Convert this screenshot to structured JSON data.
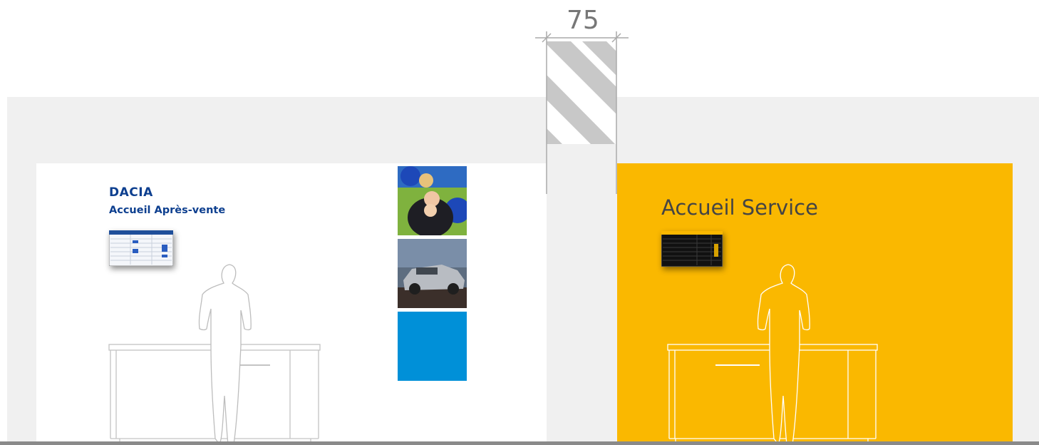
{
  "brand": "DACIA",
  "left_zone": {
    "title": "Accueil Après-vente"
  },
  "right_zone": {
    "title": "Accueil Service"
  },
  "dimension": {
    "value": "75"
  },
  "colors": {
    "wall": "#f0f0f0",
    "left_panel": "#ffffff",
    "right_panel": "#fab800",
    "brand_blue": "#0d3f8f",
    "tile_blue": "#0090d8",
    "hatch_gray": "#c8c8c8"
  },
  "icons": [
    "dacia-logo",
    "person-silhouette",
    "reception-desk",
    "display-screen"
  ]
}
